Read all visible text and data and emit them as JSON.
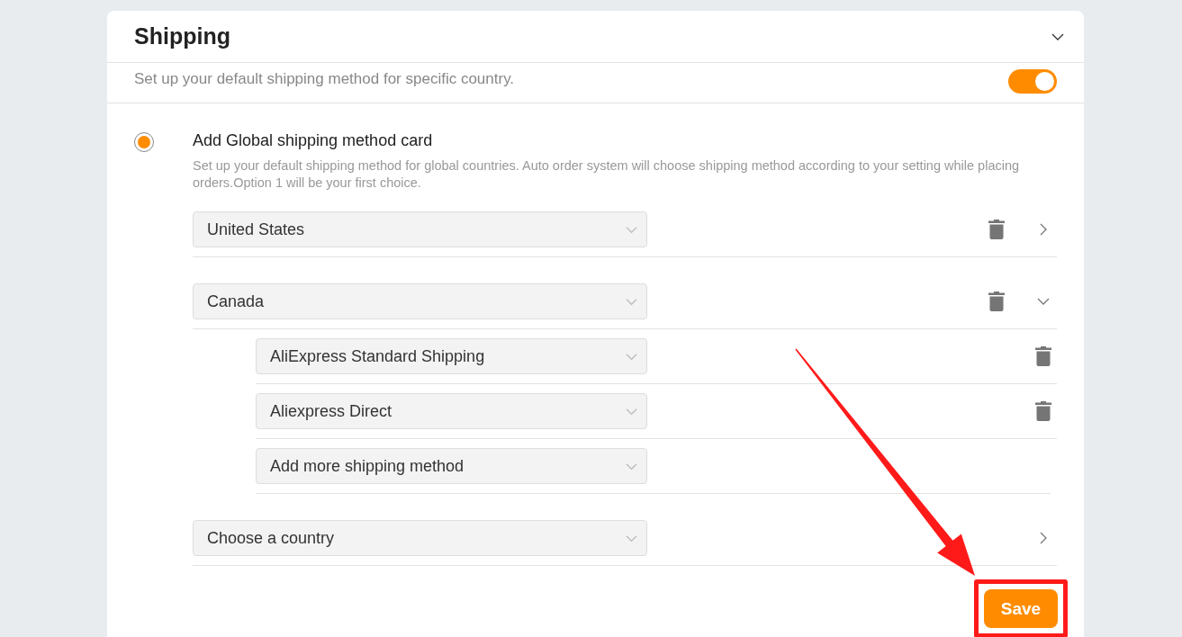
{
  "section": {
    "title": "Shipping",
    "expanded": true,
    "description": "Set up your default shipping method for specific country.",
    "enabled": true
  },
  "global_card": {
    "selected": true,
    "title": "Add Global shipping method card",
    "description": "Set up your default shipping method for global countries. Auto order system will choose shipping method according to your setting while placing orders.Option 1 will be your first choice.",
    "countries": [
      {
        "kind": "country",
        "value": "United States",
        "expanded": false
      },
      {
        "kind": "country",
        "value": "Canada",
        "expanded": true,
        "methods": [
          {
            "kind": "method",
            "value": "AliExpress Standard Shipping"
          },
          {
            "kind": "method",
            "value": "Aliexpress Direct"
          },
          {
            "kind": "add",
            "value": "Add more shipping method"
          }
        ]
      },
      {
        "kind": "picker",
        "value": "Choose a country",
        "expanded": false
      }
    ]
  },
  "save_button": "Save"
}
